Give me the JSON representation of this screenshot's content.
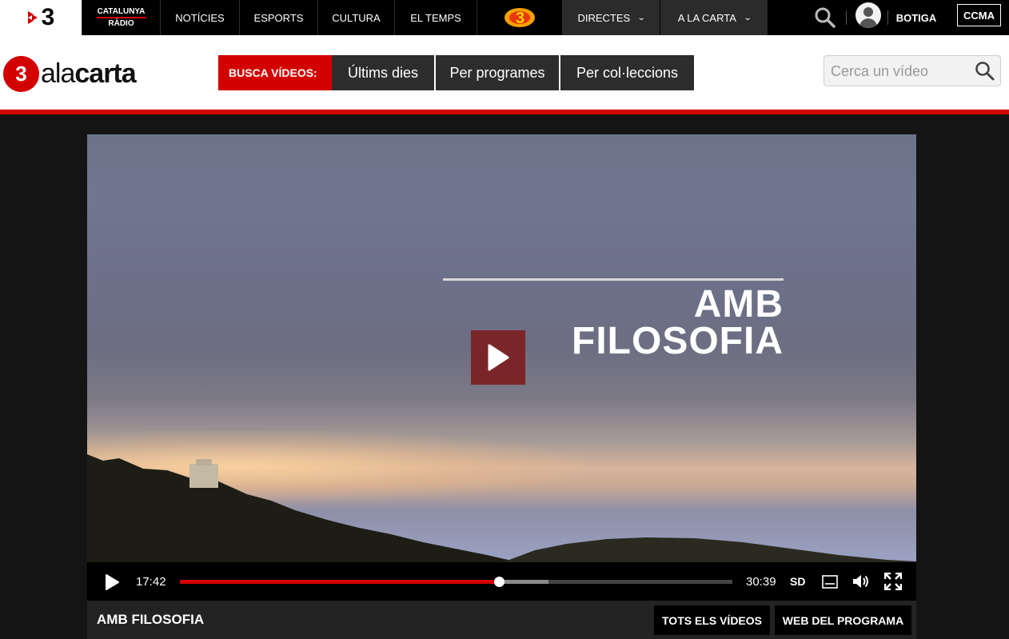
{
  "topnav": {
    "logo_text": "3",
    "catalunya_radio": {
      "line1": "CATALUNYA",
      "line2": "RÀDIO"
    },
    "items": [
      {
        "label": "NOTÍCIES"
      },
      {
        "label": "ESPORTS"
      },
      {
        "label": "CULTURA"
      },
      {
        "label": "EL TEMPS"
      },
      {
        "label": "DIRECTES"
      },
      {
        "label": "A LA CARTA"
      }
    ],
    "botiga": "BOTIGA",
    "ccma": "CCMA"
  },
  "header": {
    "logo_circle": "3",
    "logo_al": "ala",
    "logo_carta": "carta",
    "busca_label": "BUSCA VÍDEOS:",
    "filters": [
      {
        "label": "Últims dies"
      },
      {
        "label": "Per programes"
      },
      {
        "label": "Per col·leccions"
      }
    ],
    "search_placeholder": "Cerca un vídeo"
  },
  "video": {
    "overlay_title_line1": "AMB",
    "overlay_title_line2": "FILOSOFIA",
    "current_time": "17:42",
    "duration": "30:39",
    "played_fraction": 0.578,
    "buffered_fraction": 0.667,
    "quality": "SD"
  },
  "info": {
    "program_title": "AMB FILOSOFIA",
    "all_videos_label": "TOTS ELS VÍDEOS",
    "program_web_label": "WEB DEL PROGRAMA"
  },
  "colors": {
    "accent": "#d30000",
    "nav_bg": "#000000",
    "dark_button": "#2d2d2d"
  }
}
